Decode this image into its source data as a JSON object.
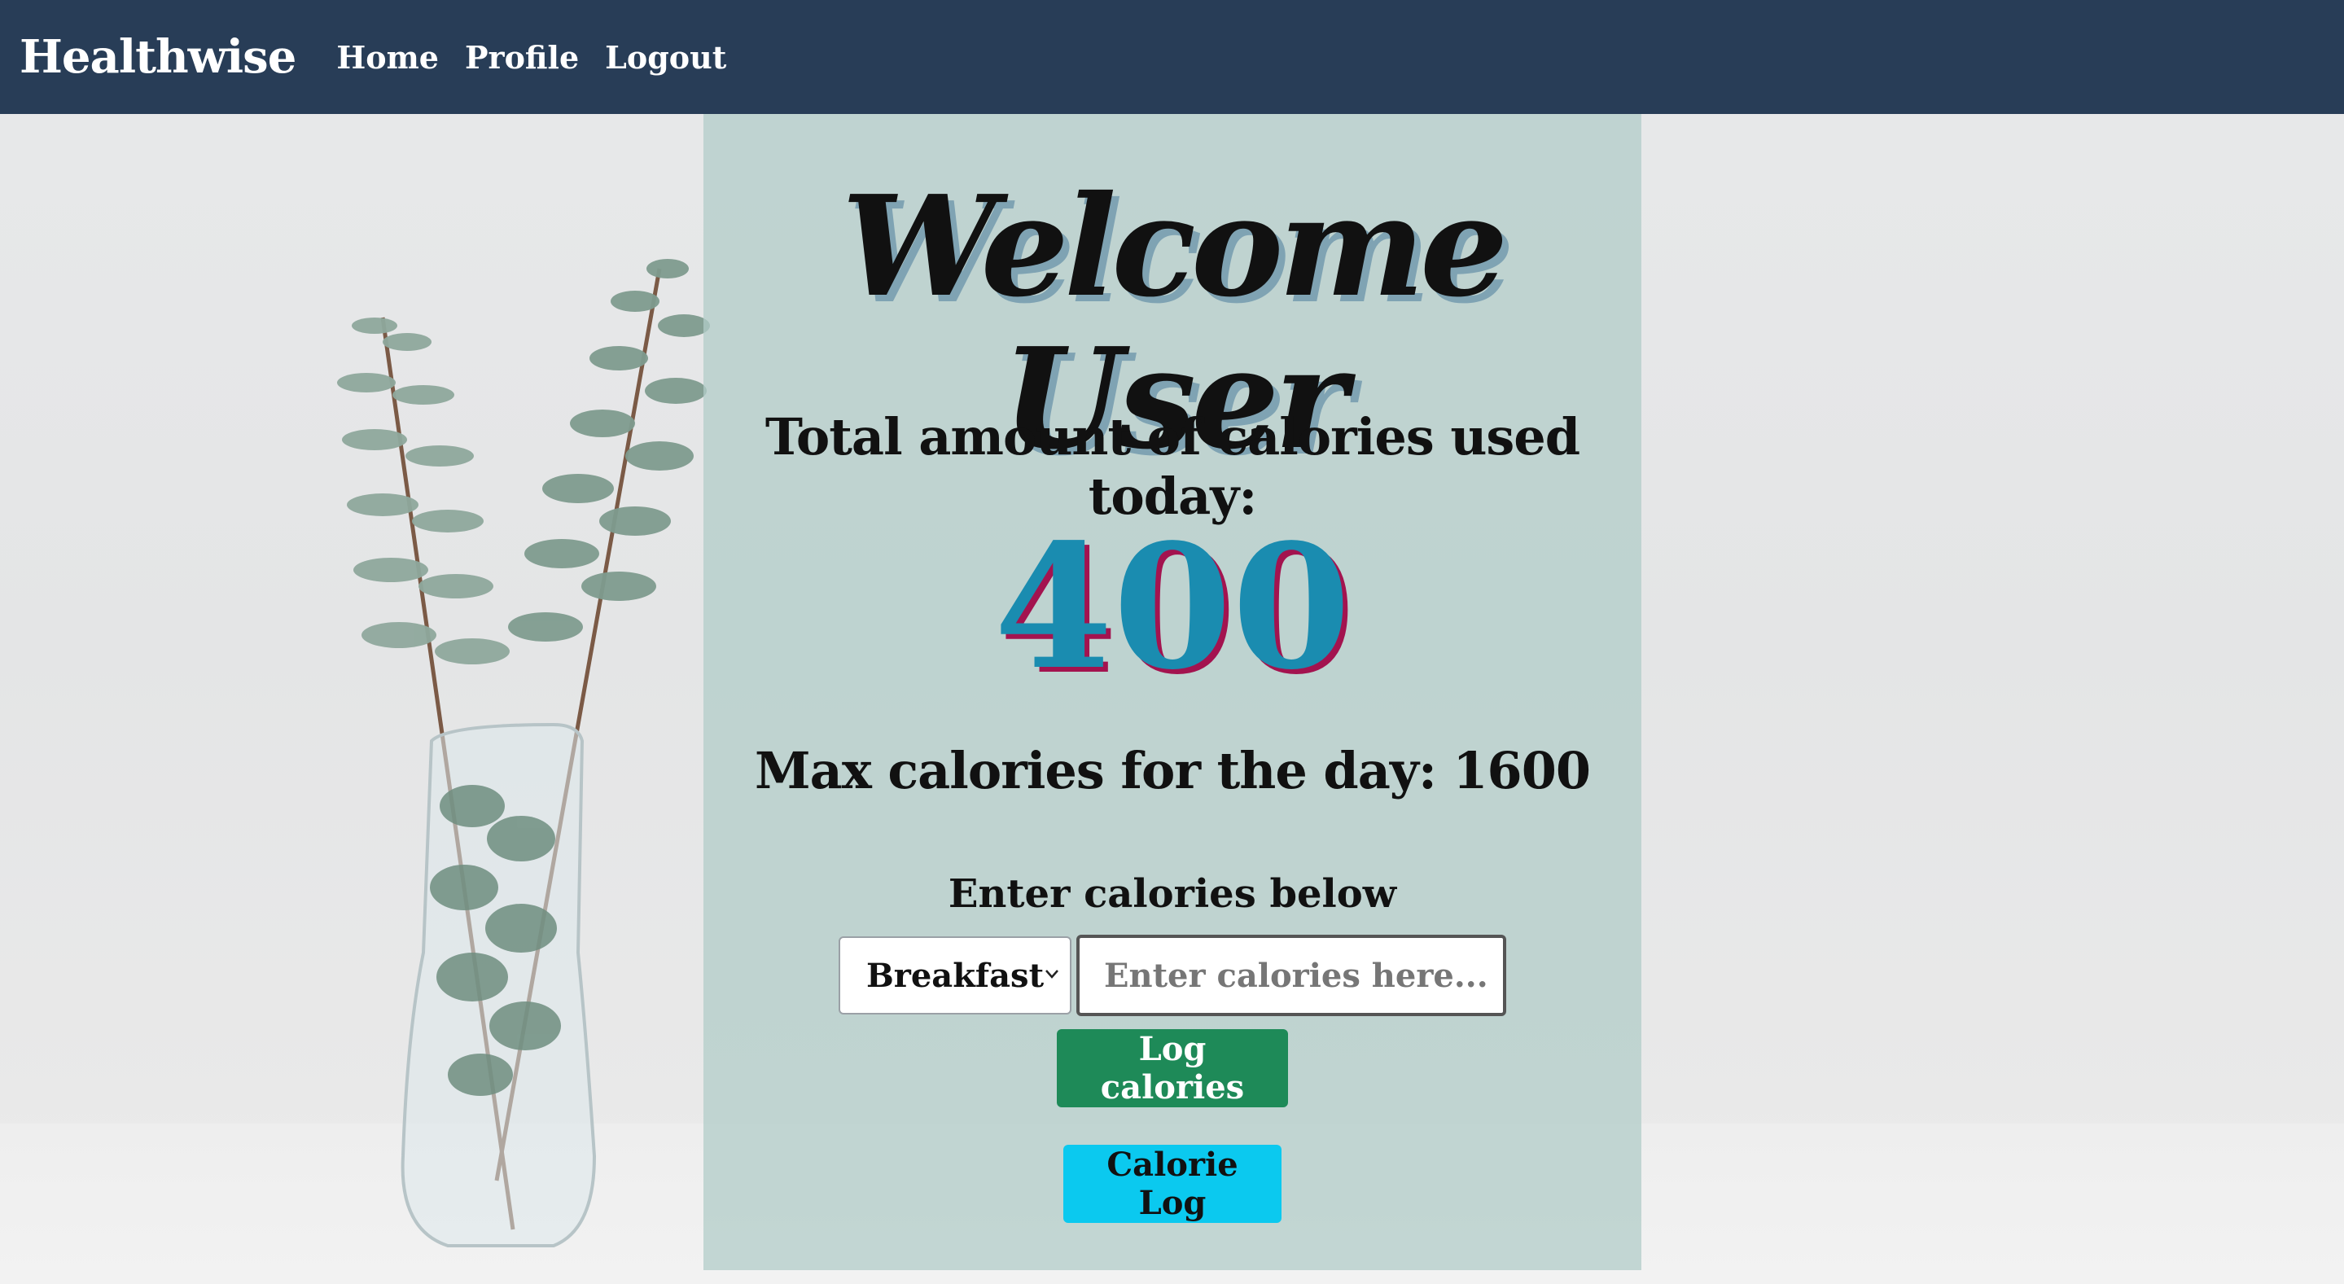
{
  "nav": {
    "brand": "Healthwise",
    "links": [
      "Home",
      "Profile",
      "Logout"
    ]
  },
  "main": {
    "welcome": "Welcome User",
    "total_label": "Total amount of calories used today:",
    "calories_used": "400",
    "max_label": "Max calories for the day: 1600",
    "enter_label": "Enter calories below",
    "meal_select": {
      "selected": "Breakfast"
    },
    "calorie_input": {
      "value": "",
      "placeholder": "Enter calories here..."
    },
    "log_button": "Log calories",
    "calorie_log_button": "Calorie Log"
  },
  "colors": {
    "navbar": "#283d57",
    "panel": "#b2ccc8",
    "value_text": "#1a8cb0",
    "value_shadow": "#a3134f",
    "log_button": "#1e8a58",
    "calorie_log_button": "#0bc9ef"
  }
}
